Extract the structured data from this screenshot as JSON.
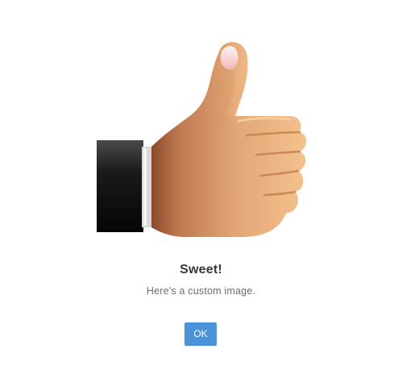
{
  "dialog": {
    "title": "Sweet!",
    "message": "Here's a custom image.",
    "confirm_label": "OK",
    "image": {
      "icon": "thumbs-up-icon"
    }
  },
  "colors": {
    "confirm_button": "#4a93d8",
    "title_text": "#3a3a3a",
    "message_text": "#6e6e6e",
    "skin": "#e8a878",
    "sleeve": "#1c1c1c"
  }
}
